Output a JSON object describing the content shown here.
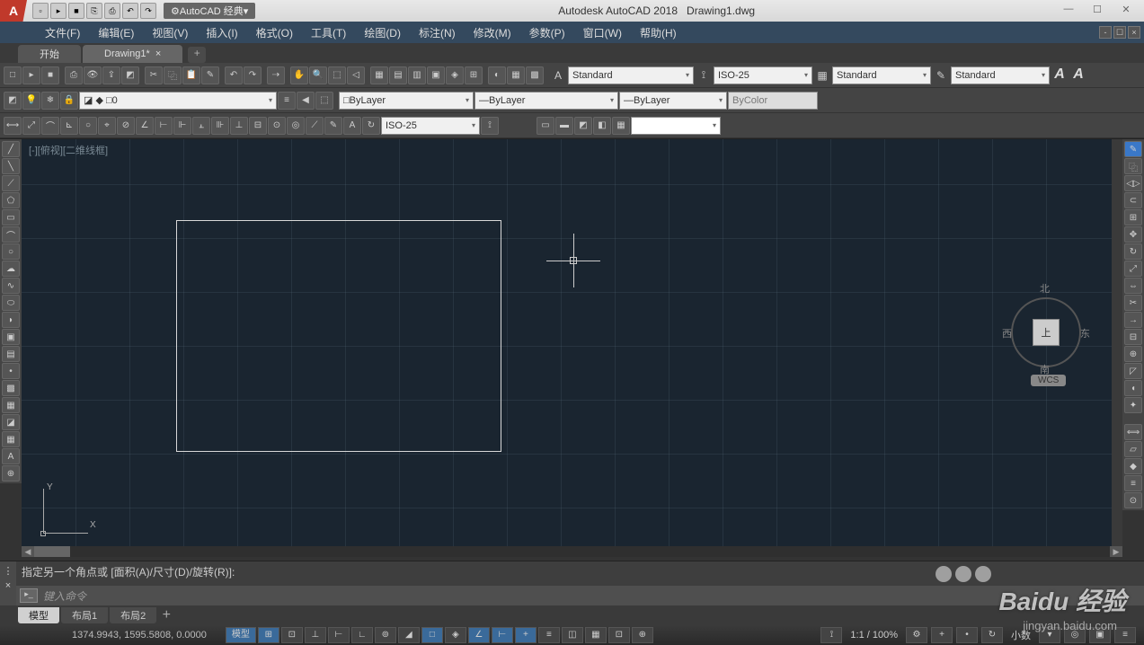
{
  "title": {
    "app": "Autodesk AutoCAD 2018",
    "doc": "Drawing1.dwg"
  },
  "workspace": "AutoCAD 经典",
  "menu": {
    "file": "文件(F)",
    "edit": "编辑(E)",
    "view": "视图(V)",
    "insert": "插入(I)",
    "format": "格式(O)",
    "tools": "工具(T)",
    "draw": "绘图(D)",
    "dimension": "标注(N)",
    "modify": "修改(M)",
    "params": "参数(P)",
    "window": "窗口(W)",
    "help": "帮助(H)"
  },
  "filetabs": {
    "start": "开始",
    "current": "Drawing1*"
  },
  "props": {
    "color": "ByLayer",
    "linetype": "ByLayer",
    "lineweight": "ByLayer",
    "plotstyle": "ByColor",
    "textstyle": "Standard",
    "dimstyle": "ISO-25",
    "tablestyle": "Standard",
    "mlstyle": "Standard",
    "layer": "0",
    "dimstyle2": "ISO-25"
  },
  "viewport": {
    "label": "[-][俯视][二维线框]"
  },
  "navcube": {
    "n": "北",
    "s": "南",
    "e": "东",
    "w": "西",
    "top": "上",
    "wcs": "WCS"
  },
  "ucs": {
    "x": "X",
    "y": "Y"
  },
  "cmd": {
    "history": "指定另一个角点或 [面积(A)/尺寸(D)/旋转(R)]:",
    "placeholder": "键入命令"
  },
  "layouts": {
    "model": "模型",
    "l1": "布局1",
    "l2": "布局2"
  },
  "status": {
    "coords": "1374.9943, 1595.5808, 0.0000",
    "model": "模型",
    "scale": "1:1 / 100%",
    "decimal": "小数"
  },
  "watermark": {
    "main": "Baidu 经验",
    "sub": "jingyan.baidu.com"
  }
}
